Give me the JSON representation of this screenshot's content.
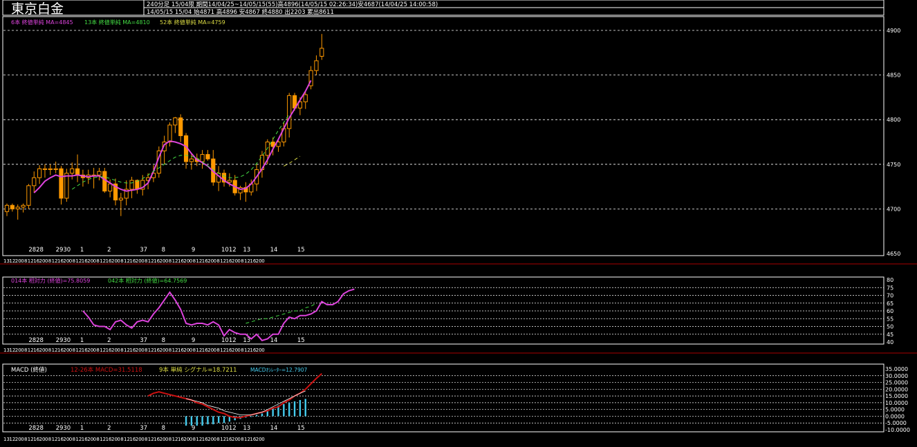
{
  "header": {
    "title": "東京白金",
    "line1": "240分足 15/04限 期間14/04/25~14/05/15(55)高4896(14/05/15 02:26:34)安4687(14/04/25 14:00:58)",
    "line2": "14/05/15 15/04 始4871 高4896 安4867 終4880 出2203 累出8611"
  },
  "colors": {
    "background": "#000000",
    "up_candle": "#000000",
    "down_candle": "#ff9900",
    "candle_border": "#ff9900",
    "ma_short": "#dd44dd",
    "ma_mid": "#44dd44",
    "ma_long": "#dddd44",
    "macd": "#cc1111",
    "signal": "#ffffff",
    "oscillator": "#44ccee",
    "separator": "#aa0000"
  },
  "x_axis": {
    "day_labels": [
      "2828",
      "2930",
      "1",
      "2",
      "37",
      "8",
      "9",
      "1012",
      "13",
      "14",
      "15"
    ],
    "hour_labels": [
      "13",
      "12",
      "20",
      "0",
      "8",
      "12",
      "16",
      "20",
      "0",
      "8",
      "12",
      "16",
      "20",
      "0",
      "8",
      "12",
      "16",
      "20",
      "0",
      "8",
      "12",
      "16",
      "20",
      "0",
      "8",
      "12",
      "16",
      "20",
      "0",
      "8",
      "12",
      "16",
      "20",
      "0",
      "8",
      "12",
      "16",
      "20",
      "0",
      "8",
      "12",
      "16",
      "20",
      "0",
      "8",
      "12",
      "16",
      "20",
      "0",
      "8",
      "12",
      "16",
      "20",
      "0"
    ]
  },
  "chart_data": [
    {
      "type": "candlestick",
      "legend": "6本 終値単純 MA=4845 13本 終値単純 MA=4810 52本 終値単純 MA=4759",
      "legend_parts": [
        "6本 終値単純 MA=4845",
        "13本 終値単純 MA=4810",
        "52本 終値単純 MA=4759"
      ],
      "ylim": [
        4650,
        4900
      ],
      "yticks": [
        4650,
        4700,
        4750,
        4800,
        4850,
        4900
      ],
      "grid": true,
      "candles": [
        [
          4697,
          4706,
          4692,
          4704
        ],
        [
          4704,
          4706,
          4697,
          4700
        ],
        [
          4700,
          4705,
          4688,
          4702
        ],
        [
          4702,
          4706,
          4696,
          4704
        ],
        [
          4704,
          4728,
          4700,
          4726
        ],
        [
          4726,
          4742,
          4718,
          4735
        ],
        [
          4735,
          4749,
          4728,
          4745
        ],
        [
          4745,
          4750,
          4735,
          4745
        ],
        [
          4745,
          4750,
          4738,
          4745
        ],
        [
          4745,
          4753,
          4740,
          4745
        ],
        [
          4745,
          4748,
          4705,
          4712
        ],
        [
          4712,
          4745,
          4708,
          4740
        ],
        [
          4740,
          4752,
          4733,
          4745
        ],
        [
          4745,
          4761,
          4730,
          4738
        ],
        [
          4738,
          4744,
          4725,
          4735
        ],
        [
          4735,
          4744,
          4728,
          4738
        ],
        [
          4738,
          4746,
          4723,
          4738
        ],
        [
          4738,
          4746,
          4732,
          4742
        ],
        [
          4742,
          4746,
          4718,
          4720
        ],
        [
          4720,
          4733,
          4713,
          4728
        ],
        [
          4728,
          4734,
          4704,
          4710
        ],
        [
          4710,
          4718,
          4692,
          4712
        ],
        [
          4712,
          4732,
          4704,
          4722
        ],
        [
          4722,
          4736,
          4712,
          4732
        ],
        [
          4732,
          4733,
          4717,
          4722
        ],
        [
          4722,
          4738,
          4715,
          4732
        ],
        [
          4732,
          4740,
          4722,
          4735
        ],
        [
          4735,
          4749,
          4730,
          4740
        ],
        [
          4740,
          4770,
          4735,
          4765
        ],
        [
          4765,
          4782,
          4750,
          4775
        ],
        [
          4775,
          4797,
          4770,
          4794
        ],
        [
          4794,
          4803,
          4785,
          4802
        ],
        [
          4802,
          4806,
          4775,
          4782
        ],
        [
          4782,
          4785,
          4745,
          4753
        ],
        [
          4753,
          4762,
          4744,
          4756
        ],
        [
          4756,
          4762,
          4748,
          4753
        ],
        [
          4753,
          4766,
          4745,
          4761
        ],
        [
          4761,
          4766,
          4754,
          4756
        ],
        [
          4756,
          4766,
          4726,
          4730
        ],
        [
          4730,
          4748,
          4720,
          4740
        ],
        [
          4740,
          4744,
          4725,
          4730
        ],
        [
          4730,
          4740,
          4725,
          4732
        ],
        [
          4732,
          4738,
          4715,
          4718
        ],
        [
          4718,
          4726,
          4710,
          4724
        ],
        [
          4724,
          4730,
          4708,
          4719
        ],
        [
          4719,
          4733,
          4715,
          4728
        ],
        [
          4728,
          4750,
          4720,
          4744
        ],
        [
          4744,
          4765,
          4735,
          4760
        ],
        [
          4760,
          4778,
          4750,
          4775
        ],
        [
          4775,
          4780,
          4760,
          4770
        ],
        [
          4770,
          4777,
          4764,
          4775
        ],
        [
          4775,
          4797,
          4770,
          4790
        ],
        [
          4790,
          4830,
          4780,
          4827
        ],
        [
          4827,
          4830,
          4810,
          4813
        ],
        [
          4813,
          4825,
          4805,
          4820
        ],
        [
          4820,
          4831,
          4812,
          4828
        ],
        [
          4838,
          4860,
          4834,
          4855
        ],
        [
          4855,
          4872,
          4850,
          4866
        ],
        [
          4871,
          4896,
          4867,
          4880
        ]
      ],
      "ma": [
        {
          "name": "6本",
          "color": "#dd44dd",
          "dash": false,
          "values": [
            null,
            null,
            null,
            null,
            null,
            4718,
            4724,
            4731,
            4735,
            4738,
            4736,
            4737,
            4737,
            4738,
            4737,
            4736,
            4737,
            4737,
            4733,
            4729,
            4725,
            4722,
            4720,
            4721,
            4722,
            4724,
            4729,
            4742,
            4758,
            4772,
            4776,
            4775,
            4773,
            4770,
            4762,
            4755,
            4752,
            4748,
            4742,
            4737,
            4732,
            4728,
            4725,
            4722,
            4723,
            4728,
            4736,
            4745,
            4755,
            4767,
            4778,
            4790,
            4802,
            4812,
            4822,
            4832,
            4844
          ]
        },
        {
          "name": "13本",
          "color": "#44dd44",
          "dash": true,
          "values": [
            null,
            null,
            null,
            null,
            null,
            null,
            null,
            null,
            null,
            null,
            null,
            null,
            4722,
            4726,
            4730,
            4733,
            4735,
            4736,
            4736,
            4734,
            4732,
            4730,
            4729,
            4729,
            4731,
            4734,
            4738,
            4742,
            4746,
            4750,
            4754,
            4758,
            4760,
            4760,
            4759,
            4757,
            4753,
            4748,
            4744,
            4740,
            4737,
            4735,
            4735,
            4736,
            4739,
            4744,
            4751,
            4759,
            4768,
            4778,
            4788,
            4797,
            4806
          ]
        },
        {
          "name": "52本",
          "color": "#dddd44",
          "dash": true,
          "values": [
            null,
            null,
            null,
            null,
            null,
            null,
            null,
            null,
            null,
            null,
            null,
            null,
            null,
            null,
            null,
            null,
            null,
            null,
            null,
            null,
            null,
            null,
            null,
            null,
            null,
            null,
            null,
            null,
            null,
            null,
            null,
            null,
            null,
            null,
            null,
            null,
            null,
            null,
            null,
            null,
            null,
            null,
            null,
            null,
            null,
            null,
            null,
            null,
            null,
            null,
            null,
            4748,
            4751,
            4755,
            4759
          ]
        }
      ]
    },
    {
      "type": "line",
      "legend": "014本 相対力 (終値)=75.8059 042本 相対力 (終値)=64.7569",
      "legend_parts": [
        "014本 相対力 (終値)=75.8059",
        "042本 相対力 (終値)=64.7569"
      ],
      "ylim": [
        40,
        80
      ],
      "yticks": [
        40,
        45,
        50,
        55,
        60,
        65,
        70,
        75,
        80
      ],
      "series": [
        {
          "name": "014本",
          "color": "#dd44dd",
          "x_start": 14,
          "values": [
            60,
            56,
            51,
            50,
            50,
            48,
            53,
            54,
            51,
            49,
            53,
            54,
            53,
            58,
            62,
            67,
            72,
            67,
            61,
            52,
            51,
            52,
            52,
            51,
            53,
            51,
            44,
            48,
            46,
            45,
            45,
            42,
            45,
            41,
            42,
            45,
            45,
            52,
            56,
            55,
            57,
            57,
            58,
            60,
            66,
            64,
            64,
            66,
            71,
            73,
            74
          ]
        },
        {
          "name": "042本",
          "color": "#44dd44",
          "x_start": 44,
          "values": [
            52,
            53,
            54,
            55,
            55,
            56,
            57,
            58,
            59,
            60,
            60,
            62,
            63,
            65
          ]
        }
      ]
    },
    {
      "type": "line",
      "legend": "MACD (終値) 12-26本 MACD=31.5118 9本 単純 シグナル=18.7211 MACDｵｼﾚｰﾀｰ=12.7907",
      "legend_parts": [
        "MACD (終値)",
        "12-26本 MACD=31.5118",
        "9本 単純 シグナル=18.7211",
        "MACDｵｼﾚｰﾀｰ=12.7907"
      ],
      "ylim": [
        -10,
        35
      ],
      "yticks": [
        35,
        30,
        25,
        20,
        15,
        10,
        5,
        0,
        -5,
        -10
      ],
      "ytick_labels": [
        "35.0000",
        "30.0000",
        "25.0000",
        "20.0000",
        "15.0000",
        "10.0000",
        "5.0000",
        "0.0000",
        "-5.0000",
        "-10.0000"
      ],
      "series": [
        {
          "name": "MACD",
          "color": "#cc1111",
          "x_start": 26,
          "values": [
            15,
            17,
            18,
            17,
            16,
            15,
            14,
            13,
            12,
            10,
            9,
            7,
            5,
            3,
            2,
            0,
            -1,
            -1,
            0,
            1,
            2,
            3,
            4,
            6,
            7,
            10,
            12,
            15,
            17,
            20,
            24,
            28,
            31.5
          ]
        },
        {
          "name": "シグナル",
          "color": "#ffffff",
          "x_start": 33,
          "values": [
            13,
            12,
            11,
            10,
            8,
            7,
            6,
            4,
            3,
            2,
            1,
            1,
            1,
            2,
            3,
            5,
            7,
            9,
            11,
            13,
            15,
            17,
            18.7
          ]
        },
        {
          "name": "MACDｵｼﾚｰﾀｰ",
          "color": "#44ccee",
          "type": "bar",
          "x_start": 33,
          "values": [
            -7,
            -7,
            -7,
            -7,
            -6,
            -6,
            -5,
            -5,
            -4,
            -3,
            -2,
            -1,
            0,
            1,
            2,
            4,
            6,
            8,
            9,
            10,
            11,
            12,
            12.8
          ]
        }
      ]
    }
  ]
}
